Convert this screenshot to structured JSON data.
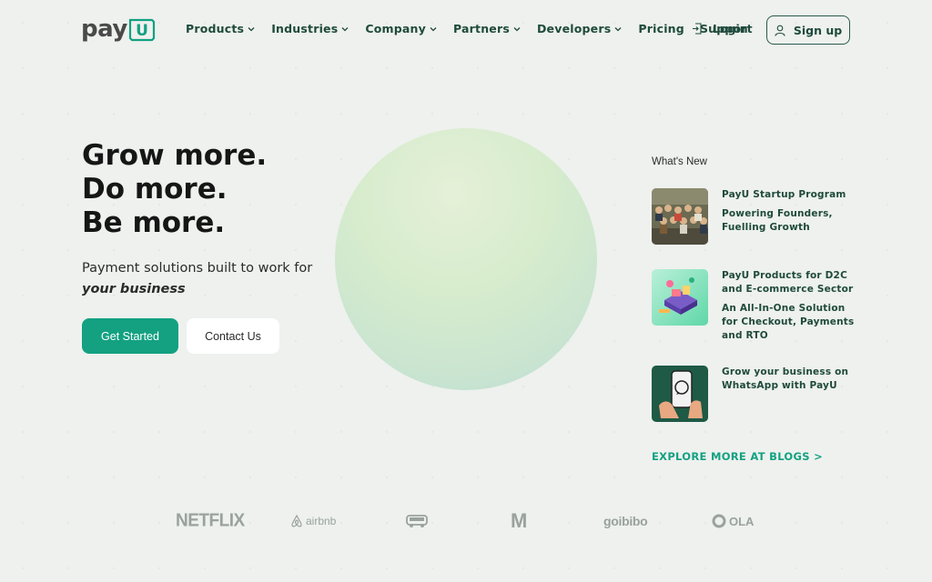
{
  "header": {
    "logo_text": "pay",
    "logo_box_text": "U",
    "nav": [
      {
        "label": "Products",
        "has_dropdown": true
      },
      {
        "label": "Industries",
        "has_dropdown": true
      },
      {
        "label": "Company",
        "has_dropdown": true
      },
      {
        "label": "Partners",
        "has_dropdown": true
      },
      {
        "label": "Developers",
        "has_dropdown": true
      },
      {
        "label": "Pricing",
        "has_dropdown": false
      },
      {
        "label": "Support",
        "has_dropdown": false
      }
    ],
    "login_label": "Login",
    "signup_label": "Sign up"
  },
  "hero": {
    "title_lines": [
      "Grow more.",
      "Do more.",
      "Be more."
    ],
    "subtitle_prefix": "Payment solutions built to work for ",
    "subtitle_emphasis": "your business",
    "cta_primary": "Get Started",
    "cta_secondary": "Contact Us"
  },
  "whats_new": {
    "title": "What's New",
    "items": [
      {
        "title": "PayU Startup Program",
        "subtitle": "Powering Founders, Fuelling Growth",
        "thumb_icon": "team-photo-icon"
      },
      {
        "title": "PayU Products for D2C and E-commerce Sector",
        "subtitle": "An All-In-One Solution for Checkout, Payments and RTO",
        "thumb_icon": "ecommerce-illustration-icon"
      },
      {
        "title": "Grow your business on WhatsApp with PayU",
        "subtitle": "",
        "thumb_icon": "whatsapp-phone-icon"
      }
    ],
    "explore_label": "EXPLORE MORE AT BLOGS >"
  },
  "brands": {
    "netflix": "NETFLIX",
    "airbnb": "airbnb",
    "myntra": "M",
    "goibibo": "goibibo",
    "ola": "OLA"
  },
  "colors": {
    "accent": "#13a182",
    "nav_text": "#1f4a3c",
    "background": "#eef1ee"
  }
}
